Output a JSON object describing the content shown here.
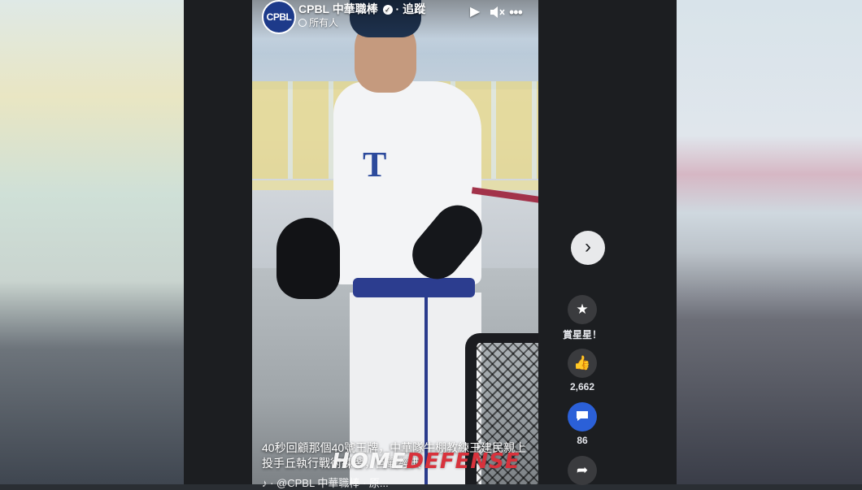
{
  "post": {
    "page_name": "CPBL 中華職棒",
    "follow_label": "· 追蹤",
    "audience": "所有人",
    "avatar_text": "CPBL"
  },
  "player_controls": {
    "play_icon": "play-icon",
    "mute_icon": "mute-icon",
    "more_icon": "more-icon"
  },
  "caption": {
    "text": "40秒回顧那個40號王牌，中華隊牛棚教練王建民親上投手丘執行戰術練習，回戰經典",
    "sub_text": "♪ · @CPBL 中華職棒 · 原..."
  },
  "watermark": {
    "part1": "HOME",
    "part2": "DEFENSE"
  },
  "actions": {
    "stars_label": "賞星星！",
    "likes_count": "2,662",
    "comments_count": "86"
  },
  "colors": {
    "accent_blue": "#2b60d8",
    "watermark_red": "#d8323c"
  }
}
